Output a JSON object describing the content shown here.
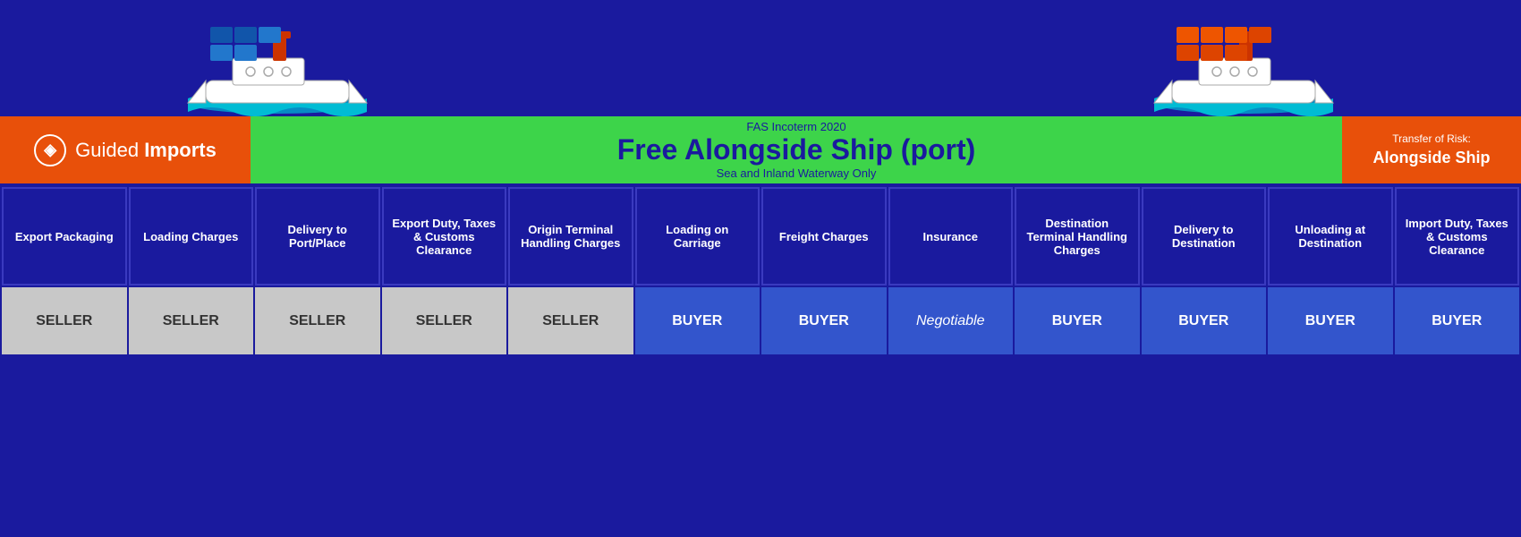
{
  "logo": {
    "icon": "◈",
    "text_normal": "Guided ",
    "text_bold": "Imports"
  },
  "header": {
    "incoterm_label": "FAS Incoterm 2020",
    "title": "Free Alongside Ship (port)",
    "subtitle": "Sea and Inland Waterway Only"
  },
  "transfer": {
    "label": "Transfer of Risk:",
    "value": "Alongside Ship"
  },
  "columns": [
    {
      "header": "Export Packaging",
      "value": "SELLER",
      "type": "seller"
    },
    {
      "header": "Loading Charges",
      "value": "SELLER",
      "type": "seller"
    },
    {
      "header": "Delivery to Port/Place",
      "value": "SELLER",
      "type": "seller"
    },
    {
      "header": "Export Duty, Taxes & Customs Clearance",
      "value": "SELLER",
      "type": "seller"
    },
    {
      "header": "Origin Terminal Handling Charges",
      "value": "SELLER",
      "type": "seller"
    },
    {
      "header": "Loading on Carriage",
      "value": "BUYER",
      "type": "buyer"
    },
    {
      "header": "Freight Charges",
      "value": "BUYER",
      "type": "buyer"
    },
    {
      "header": "Insurance",
      "value": "Negotiable",
      "type": "negotiable"
    },
    {
      "header": "Destination Terminal Handling Charges",
      "value": "BUYER",
      "type": "buyer"
    },
    {
      "header": "Delivery to Destination",
      "value": "BUYER",
      "type": "buyer"
    },
    {
      "header": "Unloading at Destination",
      "value": "BUYER",
      "type": "buyer"
    },
    {
      "header": "Import Duty, Taxes & Customs Clearance",
      "value": "BUYER",
      "type": "buyer"
    }
  ]
}
